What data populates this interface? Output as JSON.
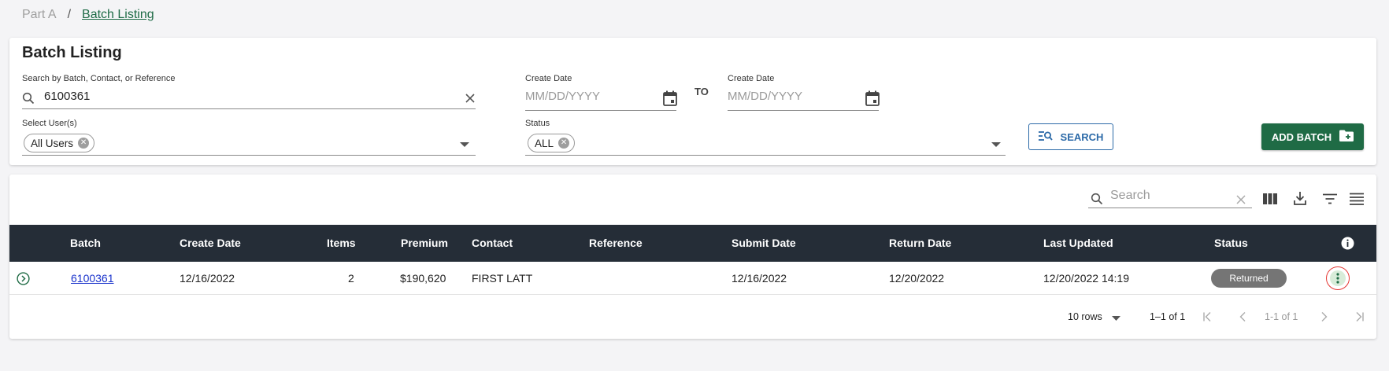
{
  "breadcrumb": {
    "parent": "Part A",
    "separator": "/",
    "current": "Batch Listing"
  },
  "page_title": "Batch Listing",
  "search": {
    "label": "Search by Batch, Contact, or Reference",
    "value": "6100361"
  },
  "create_date_from": {
    "label": "Create Date",
    "placeholder": "MM/DD/YYYY"
  },
  "to_label": "TO",
  "create_date_to": {
    "label": "Create Date",
    "placeholder": "MM/DD/YYYY"
  },
  "users_select": {
    "label": "Select User(s)",
    "chip": "All Users"
  },
  "status_select": {
    "label": "Status",
    "chip": "ALL"
  },
  "buttons": {
    "search": "SEARCH",
    "add_batch": "ADD BATCH"
  },
  "table_toolbar": {
    "search_placeholder": "Search"
  },
  "table": {
    "headers": [
      "Batch",
      "Create Date",
      "Items",
      "Premium",
      "Contact",
      "Reference",
      "Submit Date",
      "Return Date",
      "Last Updated",
      "Status"
    ],
    "rows": [
      {
        "batch": "6100361",
        "create_date": "12/16/2022",
        "items": "2",
        "premium": "$190,620",
        "contact": "FIRST LATT",
        "reference": "",
        "submit_date": "12/16/2022",
        "return_date": "12/20/2022",
        "last_updated": "12/20/2022 14:19",
        "status": "Returned"
      }
    ]
  },
  "pagination": {
    "rows_per_page": "10 rows",
    "range": "1–1 of 1",
    "page_info": "1-1 of 1"
  },
  "colors": {
    "accent_green": "#1f6b45",
    "header_dark": "#252d37",
    "link_blue": "#1a33cc",
    "search_blue": "#2c6aa8",
    "status_grey": "#757575"
  }
}
